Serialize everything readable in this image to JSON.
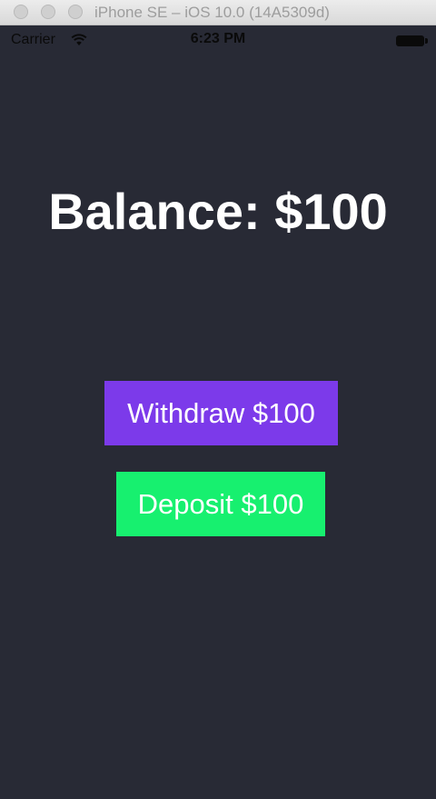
{
  "window": {
    "title": "iPhone SE – iOS 10.0 (14A5309d)"
  },
  "statusbar": {
    "carrier": "Carrier",
    "time": "6:23 PM"
  },
  "main": {
    "balance_text": "Balance: $100",
    "withdraw_label": "Withdraw $100",
    "deposit_label": "Deposit $100"
  },
  "colors": {
    "background": "#282a35",
    "withdraw_button": "#7c3aea",
    "deposit_button": "#17f06f",
    "text": "#ffffff"
  },
  "icons": {
    "wifi": "wifi-icon",
    "battery": "battery-icon"
  }
}
